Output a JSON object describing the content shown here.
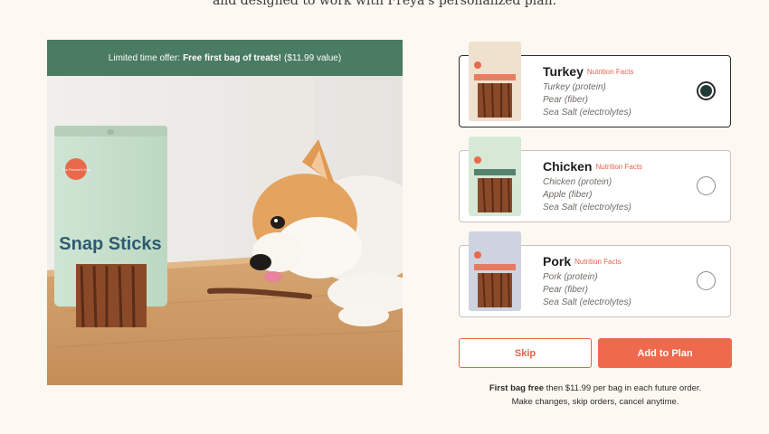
{
  "intro_text": "and designed to work with Freya's personalized plan.",
  "offer": {
    "prefix": "Limited time offer:",
    "highlight": "Free first bag of treats!",
    "suffix": "($11.99 value)"
  },
  "package_text": {
    "brand": "Snap Sticks",
    "maker_badge": "The Farmer's Dog"
  },
  "options": [
    {
      "name": "Turkey",
      "link": "Nutrition Facts",
      "ingredients": [
        "Turkey (protein)",
        "Pear (fiber)",
        "Sea Salt (electrolytes)"
      ],
      "selected": true
    },
    {
      "name": "Chicken",
      "link": "Nutrition Facts",
      "ingredients": [
        "Chicken (protein)",
        "Apple (fiber)",
        "Sea Salt (electrolytes)"
      ],
      "selected": false
    },
    {
      "name": "Pork",
      "link": "Nutrition Facts",
      "ingredients": [
        "Pork (protein)",
        "Pear (fiber)",
        "Sea Salt (electrolytes)"
      ],
      "selected": false
    }
  ],
  "buttons": {
    "skip": "Skip",
    "add": "Add to Plan"
  },
  "footer": {
    "bold": "First bag free",
    "rest": "then $11.99 per bag in each future order.",
    "line2": "Make changes, skip orders, cancel anytime."
  },
  "colors": {
    "accent": "#ef6a4d",
    "offer_bar": "#4a7b63",
    "selected_radio": "#1f3b33"
  }
}
